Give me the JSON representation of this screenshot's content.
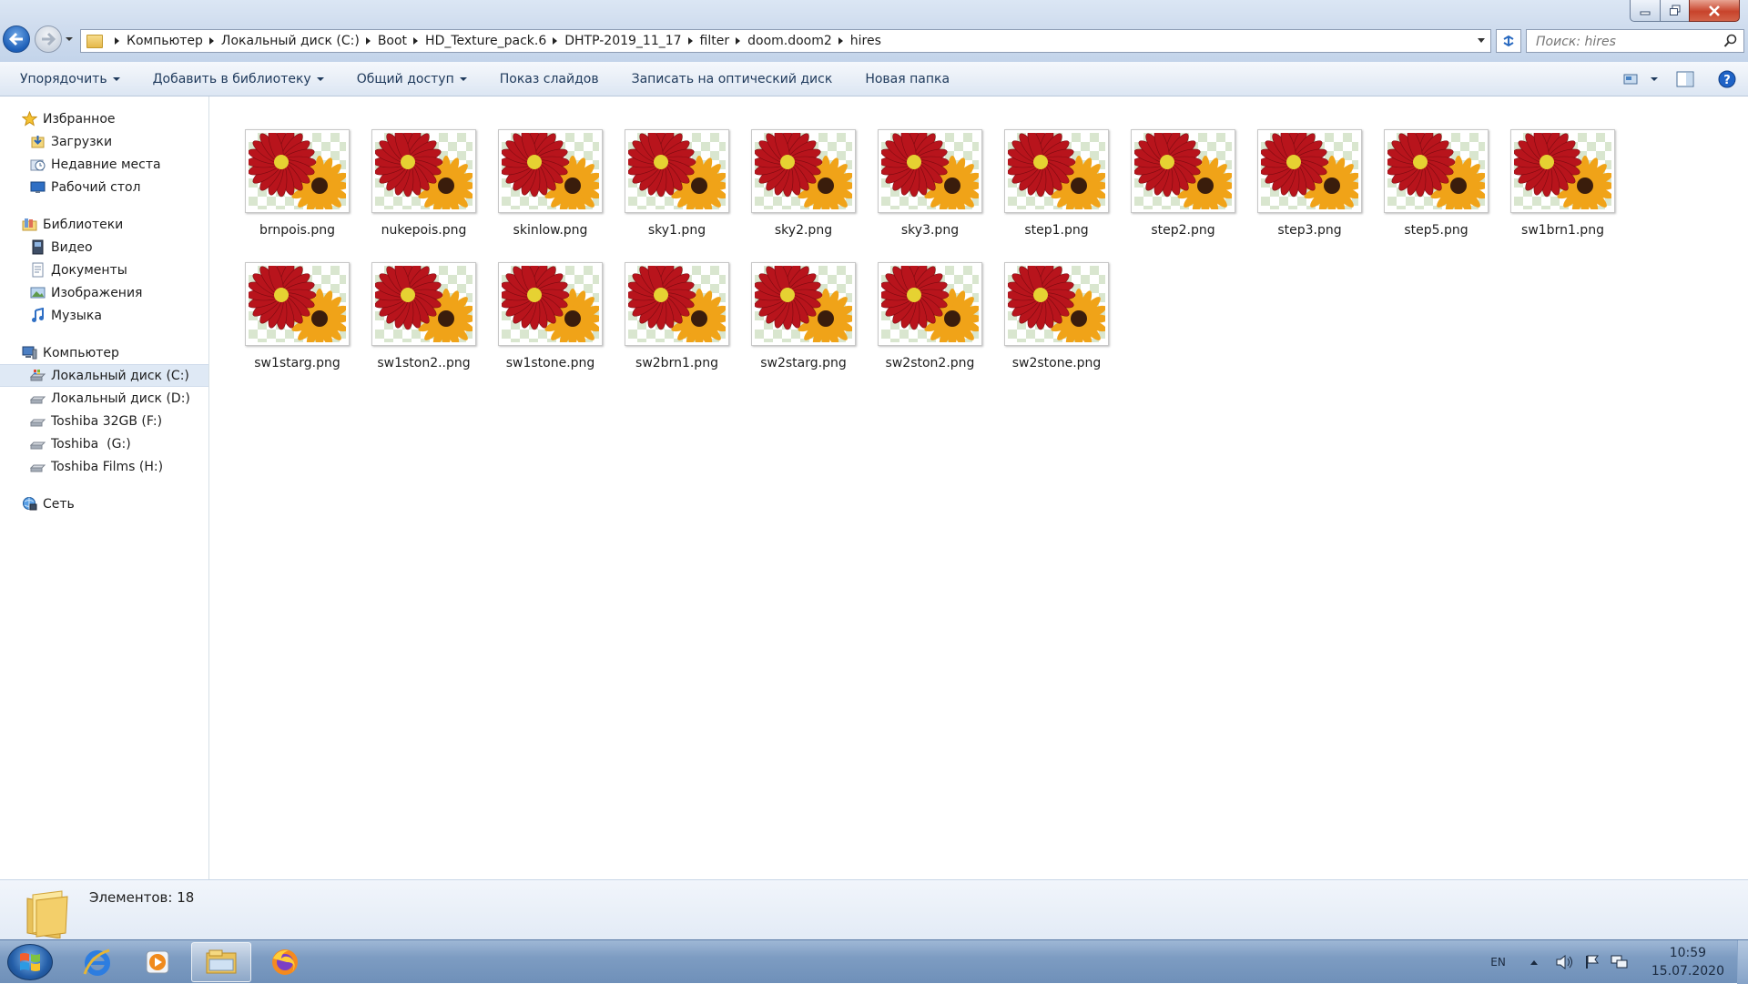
{
  "window": {
    "buttons": {
      "minimize": "minimize",
      "maximize": "maximize",
      "close": "close"
    }
  },
  "address": {
    "breadcrumbs": [
      "Компьютер",
      "Локальный диск (C:)",
      "Boot",
      "HD_Texture_pack.6",
      "DHTP-2019_11_17",
      "filter",
      "doom.doom2",
      "hires"
    ]
  },
  "search": {
    "placeholder": "Поиск: hires"
  },
  "toolbar": {
    "organize": "Упорядочить",
    "add_to_library": "Добавить в библиотеку",
    "share": "Общий доступ",
    "slideshow": "Показ слайдов",
    "burn": "Записать на оптический диск",
    "new_folder": "Новая папка"
  },
  "sidebar": {
    "favorites": {
      "label": "Избранное",
      "items": [
        "Загрузки",
        "Недавние места",
        "Рабочий стол"
      ]
    },
    "libraries": {
      "label": "Библиотеки",
      "items": [
        "Видео",
        "Документы",
        "Изображения",
        "Музыка"
      ]
    },
    "computer": {
      "label": "Компьютер",
      "items": [
        "Локальный диск (C:)",
        "Локальный диск (D:)",
        "Toshiba 32GB (F:)",
        "Toshiba  (G:)",
        "Toshiba Films (H:)"
      ]
    },
    "network": {
      "label": "Сеть"
    }
  },
  "files": [
    "brnpois.png",
    "nukepois.png",
    "skinlow.png",
    "sky1.png",
    "sky2.png",
    "sky3.png",
    "step1.png",
    "step2.png",
    "step3.png",
    "step5.png",
    "sw1brn1.png",
    "sw1starg.png",
    "sw1ston2..png",
    "sw1stone.png",
    "sw2brn1.png",
    "sw2starg.png",
    "sw2ston2.png",
    "sw2stone.png"
  ],
  "details": {
    "count_text": "Элементов: 18"
  },
  "taskbar": {
    "apps": [
      "internet-explorer-icon",
      "media-player-icon",
      "explorer-icon",
      "firefox-icon"
    ],
    "language": "EN",
    "time": "10:59",
    "date": "15.07.2020"
  },
  "colors": {
    "accent": "#1e395b",
    "selection": "#dfe9f5",
    "checker": "#d9e6cf"
  }
}
